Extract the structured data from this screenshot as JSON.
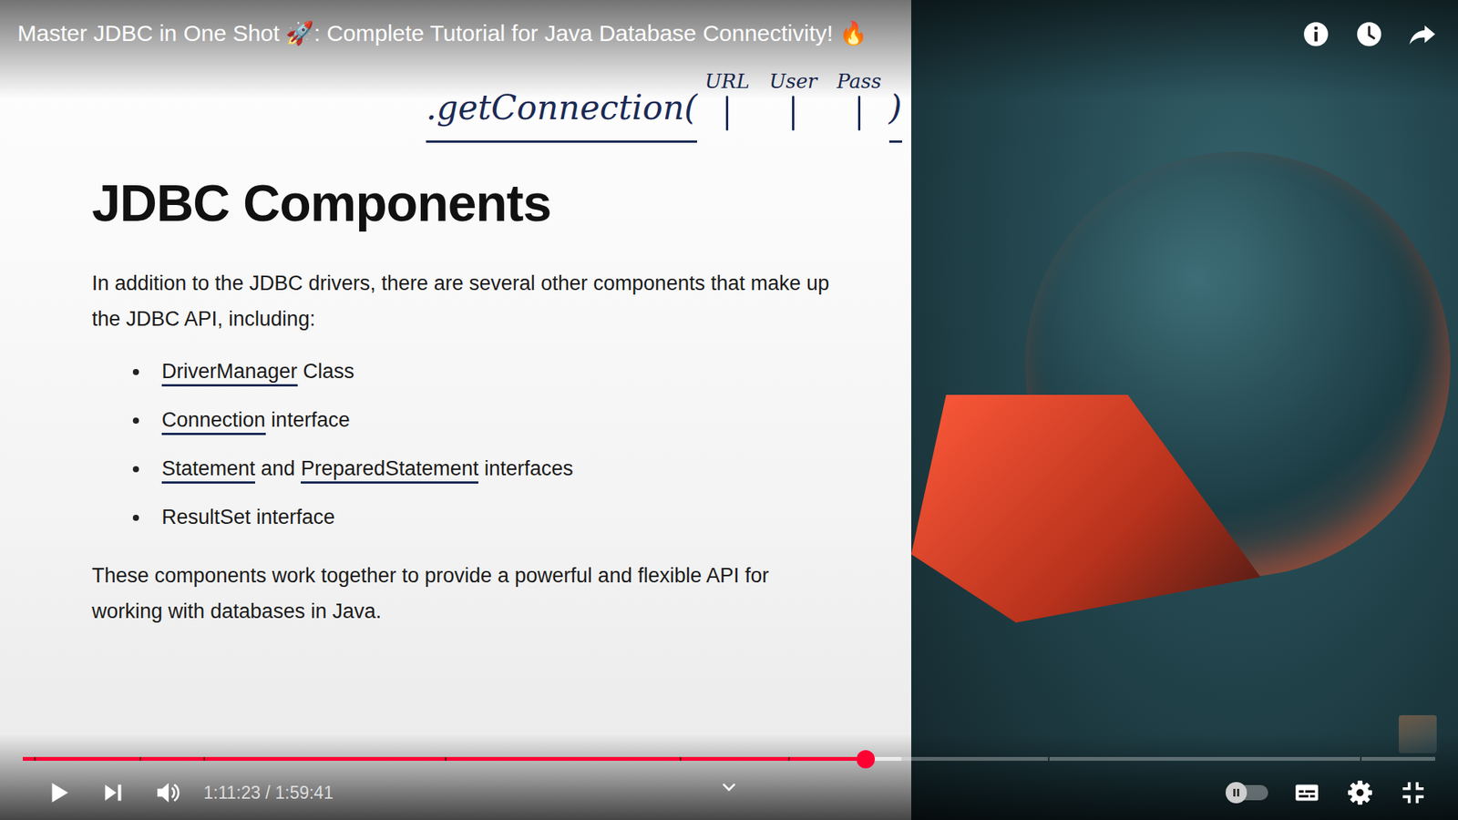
{
  "video": {
    "title": "Master JDBC in One Shot 🚀: Complete Tutorial for Java Database Connectivity! 🔥"
  },
  "slide": {
    "annotation": {
      "call": ".getConnection(",
      "args": [
        "URL",
        "User",
        "Pass"
      ],
      "close": ")"
    },
    "heading": "JDBC Components",
    "intro": "In addition to the JDBC drivers, there are several other components that make up the JDBC API, including:",
    "bullets": [
      [
        {
          "text": "DriverManager",
          "marked": true
        },
        {
          "text": " Class",
          "marked": false
        }
      ],
      [
        {
          "text": "Connection",
          "marked": true
        },
        {
          "text": " interface",
          "marked": false
        }
      ],
      [
        {
          "text": "Statement",
          "marked": true
        },
        {
          "text": " and ",
          "marked": false
        },
        {
          "text": "PreparedStatement",
          "marked": true
        },
        {
          "text": " interfaces",
          "marked": false
        }
      ],
      [
        {
          "text": "ResultSet interface",
          "marked": false
        }
      ]
    ],
    "outro": "These components work together to provide a powerful and flexible API for working with databases in Java."
  },
  "player": {
    "playing": false,
    "level": 0.597,
    "buffered": 0.622,
    "chapter_marks": [
      0.008,
      0.083,
      0.128,
      0.299,
      0.465,
      0.542,
      0.726,
      0.947
    ],
    "time": "1:11:23 / 1:59:41",
    "autoplay": false,
    "captions": false
  }
}
